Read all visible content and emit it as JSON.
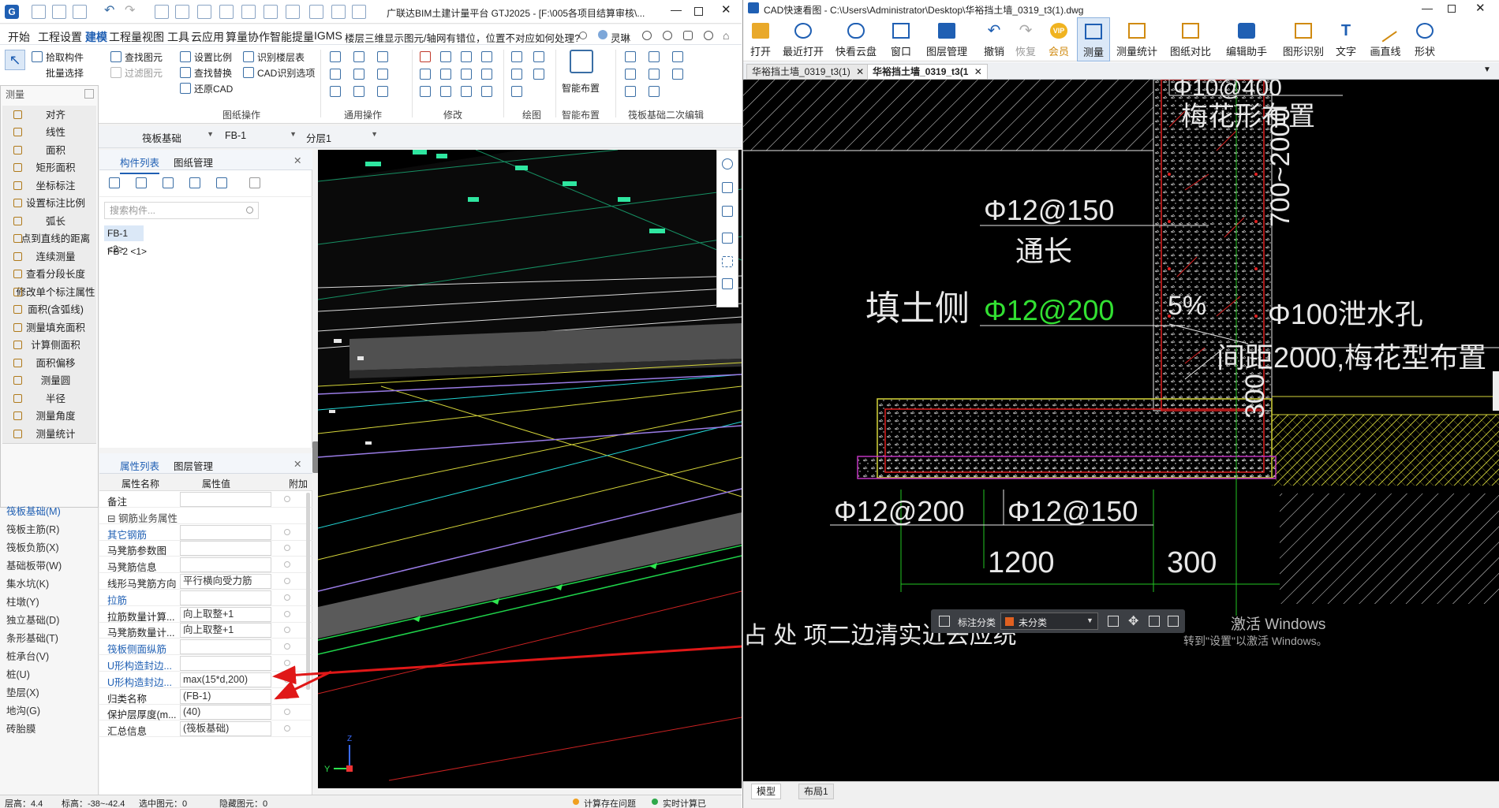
{
  "left_app": {
    "title": "广联达BIM土建计量平台 GTJ2025 - [F:\\005各项目结算审核\\...",
    "menu": [
      "开始",
      "工程设置",
      "建模",
      "工程量",
      "视图",
      "工具",
      "云应用",
      "算量协作",
      "智能提量",
      "IGMS"
    ],
    "menu_active": "建模",
    "question": "楼层三维显示图元/轴网有错位，位置不对应如何处理?",
    "user": "灵琳",
    "ribbon": {
      "select": "选择",
      "pick_member": "拾取构件",
      "batch_select": "批量选择",
      "find_element": "查找图元",
      "filter_element": "过滤图元",
      "set_scale": "设置比例",
      "find_replace": "查找替换",
      "restore_cad": "还原CAD",
      "identify_floor": "识别楼层表",
      "cad_options": "CAD识别选项",
      "group_drawing": "图纸操作",
      "group_general": "通用操作",
      "group_modify": "修改",
      "group_draw": "绘图",
      "smart_layout": "智能布置",
      "group_smart": "智能布置",
      "group_raft": "筏板基础二次编辑"
    },
    "measure_menu": {
      "title": "测量",
      "items": [
        "对齐",
        "线性",
        "面积",
        "矩形面积",
        "坐标标注",
        "设置标注比例",
        "弧长",
        "点到直线的距离",
        "连续测量",
        "查看分段长度",
        "修改单个标注属性",
        "面积(含弧线)",
        "测量填充面积",
        "计算侧面积",
        "面积偏移",
        "测量圆",
        "半径",
        "测量角度",
        "测量统计"
      ]
    },
    "selectors": [
      "筏板基础",
      "FB-1",
      "分层1"
    ],
    "nav": [
      "筏板基础(M)",
      "筏板主筋(R)",
      "筏板负筋(X)",
      "基础板带(W)",
      "集水坑(K)",
      "柱墩(Y)",
      "独立基础(D)",
      "条形基础(T)",
      "桩承台(V)",
      "桩(U)",
      "垫层(X)",
      "地沟(G)",
      "砖胎膜"
    ],
    "component_panel": {
      "tab_components": "构件列表",
      "tab_drawings": "图纸管理",
      "search_placeholder": "搜索构件...",
      "items": [
        "FB-1 <2>",
        "FB-2 <1>"
      ]
    },
    "property_panel": {
      "tab_props": "属性列表",
      "tab_layers": "图层管理",
      "col_name": "属性名称",
      "col_value": "属性值",
      "col_extra": "附加",
      "rows": [
        {
          "name": "备注",
          "value": "",
          "blue": false
        },
        {
          "name": "钢筋业务属性",
          "value": "",
          "blue": false,
          "group": true
        },
        {
          "name": "其它钢筋",
          "value": "",
          "blue": true
        },
        {
          "name": "马凳筋参数图",
          "value": "",
          "blue": false
        },
        {
          "name": "马凳筋信息",
          "value": "",
          "blue": false
        },
        {
          "name": "线形马凳筋方向",
          "value": "平行横向受力筋",
          "blue": false
        },
        {
          "name": "拉筋",
          "value": "",
          "blue": true
        },
        {
          "name": "拉筋数量计算...",
          "value": "向上取整+1",
          "blue": false
        },
        {
          "name": "马凳筋数量计...",
          "value": "向上取整+1",
          "blue": false
        },
        {
          "name": "筏板侧面纵筋",
          "value": "",
          "blue": true
        },
        {
          "name": "U形构造封边...",
          "value": "",
          "blue": true
        },
        {
          "name": "U形构造封边...",
          "value": "max(15*d,200)",
          "blue": true
        },
        {
          "name": "归类名称",
          "value": "(FB-1)",
          "blue": false
        },
        {
          "name": "保护层厚度(m...",
          "value": "(40)",
          "blue": false
        },
        {
          "name": "汇总信息",
          "value": "(筏板基础)",
          "blue": false
        }
      ]
    },
    "status": {
      "floor_height": "层高：4.4",
      "elevation": "标高：-38~-42.4",
      "selected": "选中图元：0",
      "hidden": "隐藏图元：0",
      "check": "计算存在问题",
      "realtime": "实时计算已"
    }
  },
  "right_app": {
    "title": "CAD快速看图 - C:\\Users\\Administrator\\Desktop\\华裕挡土墙_0319_t3(1).dwg",
    "toolbar": [
      "打开",
      "最近打开",
      "快看云盘",
      "窗口",
      "图层管理",
      "撤销",
      "恢复",
      "会员",
      "测量",
      "测量统计",
      "图纸对比",
      "编辑助手",
      "图形识别",
      "文字",
      "画直线",
      "形状"
    ],
    "toolbar_active": "测量",
    "file_tabs": [
      "华裕挡土墙_0319_t3(1)",
      "华裕挡土墙_0319_t3(1"
    ],
    "drawing": {
      "t_plum": "梅花形布置",
      "t_range": "700~2000",
      "t_12_150a": "Φ12@150",
      "t_through": "通长",
      "t_fill": "填土侧",
      "t_12_200a": "Φ12@200",
      "t_pct": "5%",
      "t_drain": "Φ100泄水孔",
      "t_spacing": "间距2000,梅花型布置",
      "t_300v": "300",
      "t_12_200b": "Φ12@200",
      "t_12_150b": "Φ12@150",
      "t_1200": "1200",
      "t_300": "300",
      "t_bottom": "占  处  项二边清实近去应统",
      "t_top": "Φ10@400"
    },
    "bottom_bar": {
      "label": "标注分类",
      "value": "未分类",
      "tabs": [
        "模型",
        "布局1"
      ]
    },
    "watermark_1": "激活 Windows",
    "watermark_2": "转到\"设置\"以激活 Windows。"
  }
}
